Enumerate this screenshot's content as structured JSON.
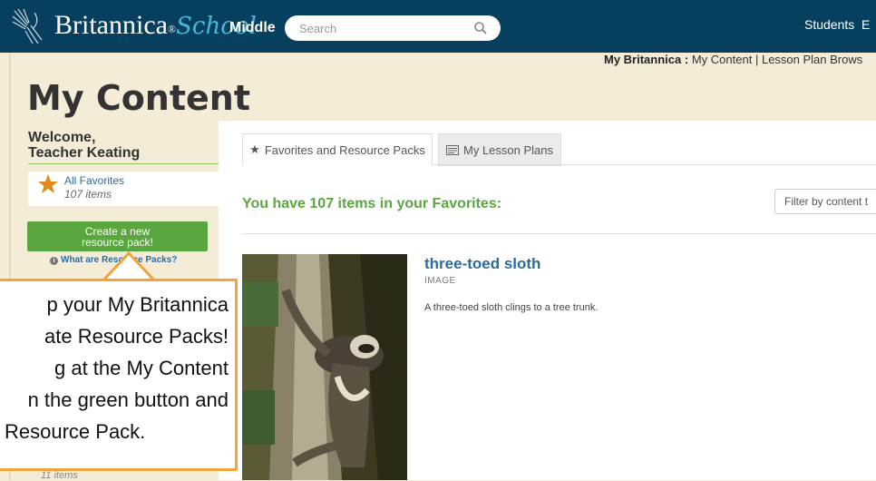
{
  "header": {
    "brand_name": "Britannica",
    "brand_reg": "®",
    "brand_school": "School",
    "tier": "Middle",
    "search_placeholder": "Search",
    "nav_students": "Students",
    "nav_cut": "E"
  },
  "breadcrumb": {
    "root": "My Britannica",
    "sep1": ":",
    "current": "My Content",
    "sep2": "|",
    "next": "Lesson Plan Brows"
  },
  "page_title": "My Content",
  "sidebar": {
    "welcome_line1": "Welcome,",
    "welcome_line2": "Teacher Keating",
    "favorites_label": "All Favorites",
    "favorites_count": "107 items",
    "create_button": "Create a new resource pack!",
    "what_link": "What are Resource Packs?",
    "bottom_count": "11 items"
  },
  "tabs": [
    {
      "label": "Favorites and Resource Packs",
      "icon": "star-icon"
    },
    {
      "label": "My Lesson Plans",
      "icon": "lesson-plan-icon"
    }
  ],
  "main": {
    "heading": "You have 107 items in your Favorites:",
    "filter_placeholder": "Filter by content t"
  },
  "item": {
    "title": "three-toed sloth",
    "type": "IMAGE",
    "description": "A three-toed sloth clings to a tree trunk."
  },
  "callout": {
    "lines": [
      "p your My Britannica",
      "ate Resource Packs!",
      "g at the My Content",
      "n the green button and",
      "Resource Pack."
    ]
  },
  "colors": {
    "header_bg": "#07405e",
    "accent_green": "#5aa63f",
    "link_blue": "#2b6c9e",
    "callout_border": "#f3a33a",
    "page_bg": "#f4ecd6"
  }
}
